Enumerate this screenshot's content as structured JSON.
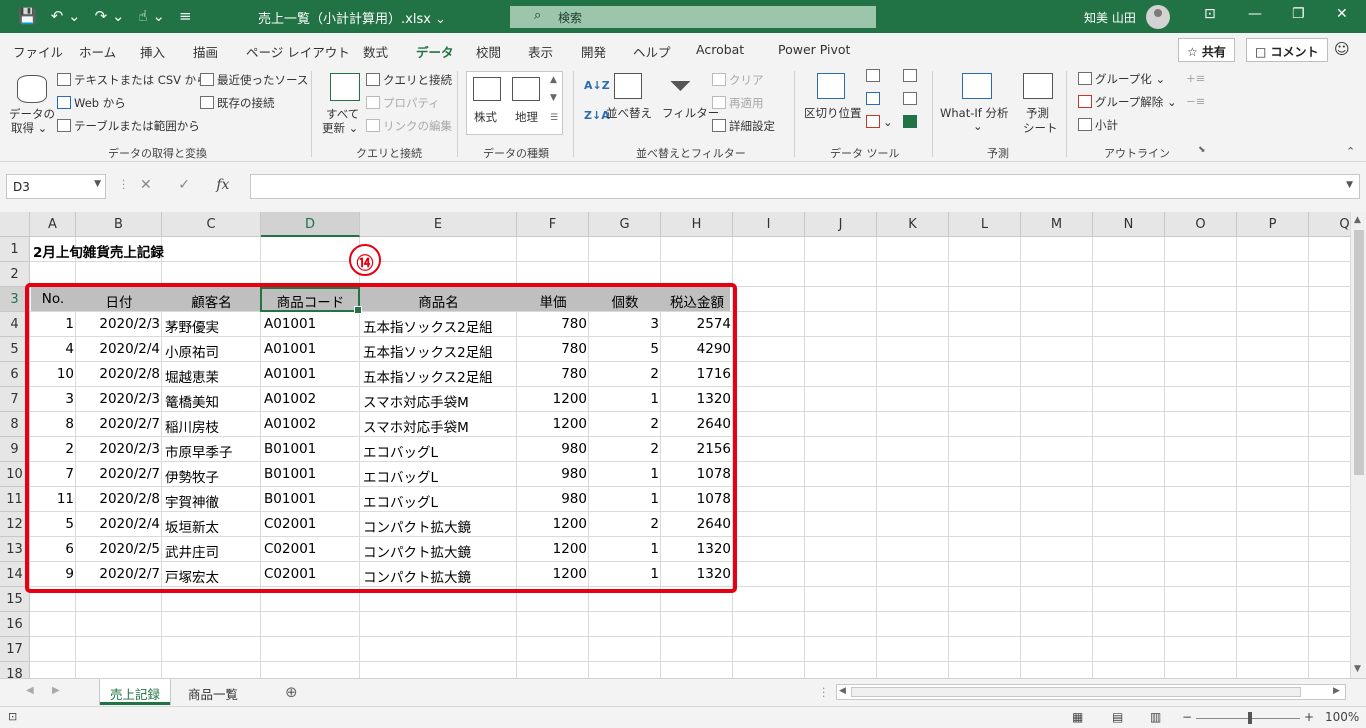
{
  "titlebar": {
    "title": "売上一覧（小計計算用）.xlsx ⌄",
    "search": "検索",
    "user": "知美 山田",
    "qat": [
      "💾",
      "↶ ⌄",
      "↷ ⌄",
      "☝ ⌄",
      "≡"
    ],
    "minimize": "—",
    "restore": "❐",
    "close": "✕",
    "ribbon_display": "⊡"
  },
  "tabs": [
    "ファイル",
    "ホーム",
    "挿入",
    "描画",
    "ページ レイアウト",
    "数式",
    "データ",
    "校閲",
    "表示",
    "開発",
    "ヘルプ",
    "Acrobat",
    "Power Pivot"
  ],
  "active_tab": "データ",
  "share": {
    "label": "☆ 共有",
    "comment": "□ コメント",
    "smile": "☺"
  },
  "ribbon": {
    "get_data": "データの",
    "get_data2": "取得 ⌄",
    "text_csv": "テキストまたは CSV から",
    "web": "Web から",
    "table_range": "テーブルまたは範囲から",
    "recent": "最近使ったソース",
    "existing": "既存の接続",
    "group1": "データの取得と変換",
    "refresh_all": "すべて",
    "refresh_all2": "更新 ⌄",
    "queries": "クエリと接続",
    "properties": "プロパティ",
    "edit_links": "リンクの編集",
    "group2": "クエリと接続",
    "stocks": "株式",
    "geography": "地理",
    "group3": "データの種類",
    "sort": "並べ替え",
    "filter": "フィルター",
    "clear": "クリア",
    "reapply": "再適用",
    "advanced": "詳細設定",
    "group4": "並べ替えとフィルター",
    "text_to_columns": "区切り位置",
    "group5": "データ ツール",
    "whatif": "What-If 分析",
    "whatif2": "⌄",
    "forecast": "予測",
    "forecast2": "シート",
    "group6": "予測",
    "group_btn": "グループ化",
    "ungroup_btn": "グループ解除",
    "subtotal": "小計",
    "group7": "アウトライン"
  },
  "namebox": "D3",
  "formula": "",
  "columns": [
    "A",
    "B",
    "C",
    "D",
    "E",
    "F",
    "G",
    "H",
    "I",
    "J",
    "K",
    "L",
    "M",
    "N",
    "O",
    "P",
    "Q"
  ],
  "rows": [
    "1",
    "2",
    "3",
    "4",
    "5",
    "6",
    "7",
    "8",
    "9",
    "10",
    "11",
    "12",
    "13",
    "14",
    "15",
    "16",
    "17",
    "18"
  ],
  "sheet_title": "2月上旬雑貨売上記録",
  "table_headers": [
    "No.",
    "日付",
    "顧客名",
    "商品コード",
    "商品名",
    "単価",
    "個数",
    "税込金額"
  ],
  "table_rows": [
    [
      "1",
      "2020/2/3",
      "茅野優実",
      "A01001",
      "五本指ソックス2足組",
      "780",
      "3",
      "2574"
    ],
    [
      "4",
      "2020/2/4",
      "小原祐司",
      "A01001",
      "五本指ソックス2足組",
      "780",
      "5",
      "4290"
    ],
    [
      "10",
      "2020/2/8",
      "堀越恵茉",
      "A01001",
      "五本指ソックス2足組",
      "780",
      "2",
      "1716"
    ],
    [
      "3",
      "2020/2/3",
      "篭橋美知",
      "A01002",
      "スマホ対応手袋M",
      "1200",
      "1",
      "1320"
    ],
    [
      "8",
      "2020/2/7",
      "稲川房枝",
      "A01002",
      "スマホ対応手袋M",
      "1200",
      "2",
      "2640"
    ],
    [
      "2",
      "2020/2/3",
      "市原早季子",
      "B01001",
      "エコバッグL",
      "980",
      "2",
      "2156"
    ],
    [
      "7",
      "2020/2/7",
      "伊勢牧子",
      "B01001",
      "エコバッグL",
      "980",
      "1",
      "1078"
    ],
    [
      "11",
      "2020/2/8",
      "宇賀神徹",
      "B01001",
      "エコバッグL",
      "980",
      "1",
      "1078"
    ],
    [
      "5",
      "2020/2/4",
      "坂垣新太",
      "C02001",
      "コンパクト拡大鏡",
      "1200",
      "2",
      "2640"
    ],
    [
      "6",
      "2020/2/5",
      "武井庄司",
      "C02001",
      "コンパクト拡大鏡",
      "1200",
      "1",
      "1320"
    ],
    [
      "9",
      "2020/2/7",
      "戸塚宏太",
      "C02001",
      "コンパクト拡大鏡",
      "1200",
      "1",
      "1320"
    ]
  ],
  "annotation": "⑭",
  "sheets": [
    "売上記録",
    "商品一覧"
  ],
  "active_sheet": "売上記録",
  "add_sheet": "⊕",
  "zoom": "100%"
}
